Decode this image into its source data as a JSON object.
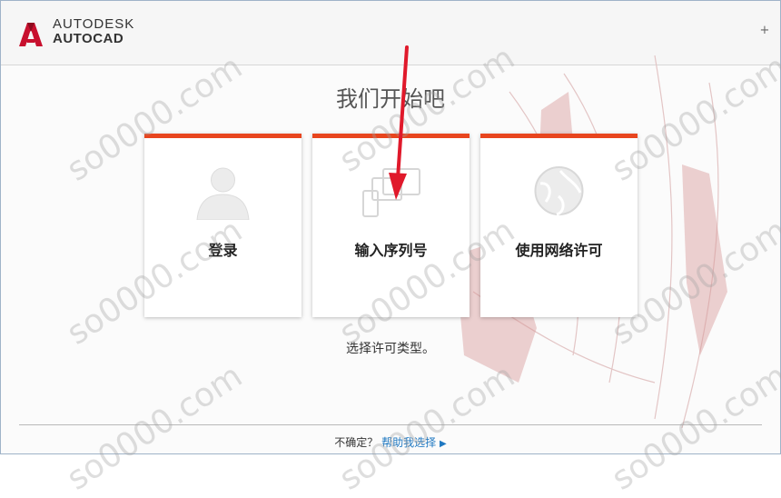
{
  "brand": {
    "company": "AUTODESK",
    "product": "AUTOCAD"
  },
  "header": {
    "corner_glyph": "+"
  },
  "heading": "我们开始吧",
  "cards": [
    {
      "label": "登录",
      "icon": "user-icon"
    },
    {
      "label": "输入序列号",
      "icon": "devices-icon"
    },
    {
      "label": "使用网络许可",
      "icon": "globe-icon"
    }
  ],
  "hint": "选择许可类型。",
  "footer": {
    "question": "不确定？",
    "link": "帮助我选择"
  },
  "watermark": {
    "text": "so0000.com"
  },
  "colors": {
    "accent": "#e8451e",
    "link": "#1f78c1",
    "annotation_arrow": "#e0192b"
  }
}
